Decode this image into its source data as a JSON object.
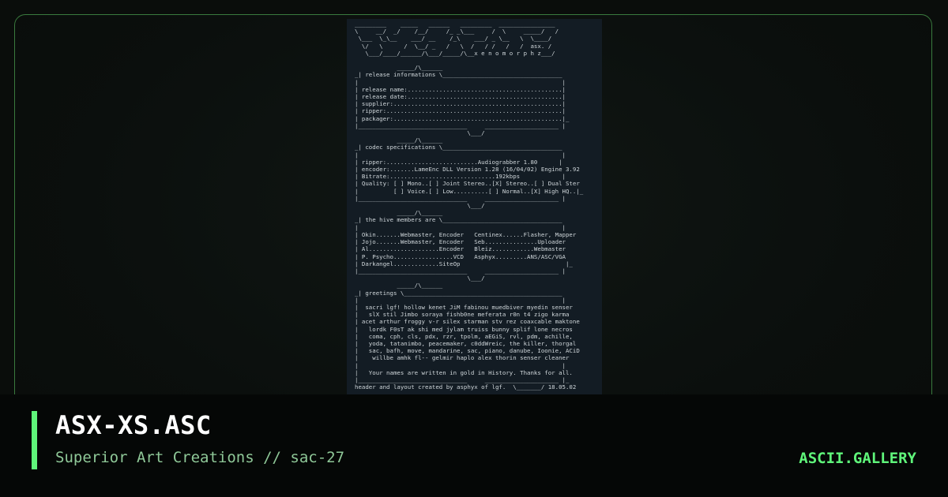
{
  "art": {
    "text": "_________    _____   ______   _________  ________________\n\\     __/  _/    /__/     /_ _\\___     /  \\     _____/   /\n \\___  \\_\\__    ___/ __    /_\\    ___/ _ \\__   \\  \\____/\n  \\/   \\      /  \\__/ _   /   \\  /   / /   /   /  asx. /\n   \\___/____/______/\\___/_____/\\__x e n o m o r p h z___/\n\n            _____/\\______\n_| release informations \\__________________________________\n|                                                          |\n| release name:............................................|\n| release date:............................................|\n| supplier:................................................|\n| ripper:..................................................|\n| packager:................................................|_\n|_______________________________     _____________________ |\n                                \\___/\n            _____/\\______\n_| codec specifications \\__________________________________\n|                                                          |\n| ripper:..........................Audiograbber 1.80      |\n| encoder:.......LameEnc DLL Version 1.28 (16/04/02) Engine 3.92\n| Bitrate:..............................192kbps            |\n| Quality: [ ] Mono..[ ] Joint Stereo..[X] Stereo..[ ] Dual Ster\n|          [ ] Voice.[ ] Low..........[ ] Normal..[X] High HQ..|_\n|_______________________________     _____________________ |\n                                \\___/\n            _____/\\______\n_| the hive members are \\__________________________________\n|                                                          |\n| Okin.......Webmaster, Encoder   Centinex......Flasher, Mapper\n| Jojo.......Webmaster, Encoder   Seb...............Uploader\n| Al....................Encoder   Bleiz............Webmaster\n| P. Psycho.................VCD   Asphyx.........ANS/ASC/VGA\n| Darkangel.............SiteOp                              |_\n|_______________________________     _____________________ |\n                                \\___/\n            _____/\\______\n_| greetings \\_____________________________________________\n|                                                          |\n|  sacri lgf! hollow kenet JiM fabinou muedbiver myedin senser\n|   slX stil Jimbo soraya fishb0ne meferata r0n t4 zigo karma\n| acet arthur froggy v-r silex starman stv rez coaxcable maktone\n|   lordk F0sT ak shi med jylam truiss bunny splif lone necros\n|   coma, cph, cls, pdx, rzr, tpolm, aEGiS, rvl, pdm, achille,\n|   yoda, tatanimbo, peacemaker, c0ddWreic, the killer, thorgal\n|   sac, bafh, move, mandarine, sac, piano, danube, Ioonie, ACiD\n|    willbe amhk fl-- gelmir haplo alex thorin senser cleaner\n|                                                          |\n|   Your names are written in gold in History. Thanks for all.\n|_______________________________     _____________________ |_\nheader and layout created by asphyx of lgf.  \\_______/ 18.05.02"
  },
  "footer": {
    "title": "ASX-XS.ASC",
    "subtitle": "Superior Art Creations // sac-27",
    "brand": "ASCII.GALLERY"
  },
  "colors": {
    "accent": "#5ff57a",
    "border": "#3a7a3e",
    "subtitle": "#8fc898",
    "art_text": "#cfd6da",
    "art_background": "#131c24"
  }
}
